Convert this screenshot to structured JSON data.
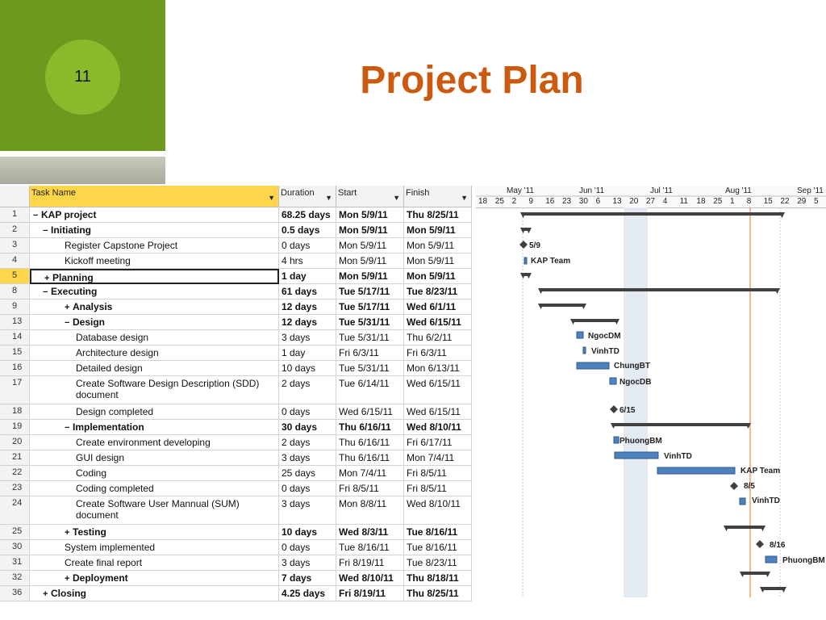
{
  "slide": {
    "number": "11",
    "title": "Project Plan"
  },
  "columns": {
    "id": "",
    "task": "Task Name",
    "duration": "Duration",
    "start": "Start",
    "finish": "Finish"
  },
  "timeline": {
    "months": [
      "May '11",
      "Jun '11",
      "Jul '11",
      "Aug '11",
      "Sep '11"
    ],
    "days": [
      "18",
      "25",
      "2",
      "9",
      "16",
      "23",
      "30",
      "6",
      "13",
      "20",
      "27",
      "4",
      "11",
      "18",
      "25",
      "1",
      "8",
      "15",
      "22",
      "29",
      "5"
    ]
  },
  "rows": [
    {
      "id": "1",
      "name": "KAP project",
      "dur": "68.25 days",
      "start": "Mon 5/9/11",
      "fin": "Thu 8/25/11",
      "bold": true,
      "level": 0,
      "toggle": "−"
    },
    {
      "id": "2",
      "name": "Initiating",
      "dur": "0.5 days",
      "start": "Mon 5/9/11",
      "fin": "Mon 5/9/11",
      "bold": true,
      "level": 1,
      "toggle": "−"
    },
    {
      "id": "3",
      "name": "Register Capstone Project",
      "dur": "0 days",
      "start": "Mon 5/9/11",
      "fin": "Mon 5/9/11",
      "bold": false,
      "level": 2,
      "toggle": ""
    },
    {
      "id": "4",
      "name": "Kickoff meeting",
      "dur": "4 hrs",
      "start": "Mon 5/9/11",
      "fin": "Mon 5/9/11",
      "bold": false,
      "level": 2,
      "toggle": ""
    },
    {
      "id": "5",
      "name": "Planning",
      "dur": "1 day",
      "start": "Mon 5/9/11",
      "fin": "Mon 5/9/11",
      "bold": true,
      "level": 1,
      "toggle": "+",
      "selected": true
    },
    {
      "id": "8",
      "name": "Executing",
      "dur": "61 days",
      "start": "Tue 5/17/11",
      "fin": "Tue 8/23/11",
      "bold": true,
      "level": 1,
      "toggle": "−"
    },
    {
      "id": "9",
      "name": "Analysis",
      "dur": "12 days",
      "start": "Tue 5/17/11",
      "fin": "Wed 6/1/11",
      "bold": true,
      "level": 2,
      "toggle": "+"
    },
    {
      "id": "13",
      "name": "Design",
      "dur": "12 days",
      "start": "Tue 5/31/11",
      "fin": "Wed 6/15/11",
      "bold": true,
      "level": 2,
      "toggle": "−"
    },
    {
      "id": "14",
      "name": "Database design",
      "dur": "3 days",
      "start": "Tue 5/31/11",
      "fin": "Thu 6/2/11",
      "bold": false,
      "level": 3,
      "toggle": ""
    },
    {
      "id": "15",
      "name": "Architecture design",
      "dur": "1 day",
      "start": "Fri 6/3/11",
      "fin": "Fri 6/3/11",
      "bold": false,
      "level": 3,
      "toggle": ""
    },
    {
      "id": "16",
      "name": "Detailed design",
      "dur": "10 days",
      "start": "Tue 5/31/11",
      "fin": "Mon 6/13/11",
      "bold": false,
      "level": 3,
      "toggle": ""
    },
    {
      "id": "17",
      "name": "Create Software Design Description (SDD)",
      "name2": "document",
      "dur": "2 days",
      "start": "Tue 6/14/11",
      "fin": "Wed 6/15/11",
      "bold": false,
      "level": 3,
      "toggle": ""
    },
    {
      "id": "18",
      "name": "Design completed",
      "dur": "0 days",
      "start": "Wed 6/15/11",
      "fin": "Wed 6/15/11",
      "bold": false,
      "level": 3,
      "toggle": ""
    },
    {
      "id": "19",
      "name": "Implementation",
      "dur": "30 days",
      "start": "Thu 6/16/11",
      "fin": "Wed 8/10/11",
      "bold": true,
      "level": 2,
      "toggle": "−"
    },
    {
      "id": "20",
      "name": "Create environment developing",
      "dur": "2 days",
      "start": "Thu 6/16/11",
      "fin": "Fri 6/17/11",
      "bold": false,
      "level": 3,
      "toggle": ""
    },
    {
      "id": "21",
      "name": "GUI design",
      "dur": "3 days",
      "start": "Thu 6/16/11",
      "fin": "Mon 7/4/11",
      "bold": false,
      "level": 3,
      "toggle": ""
    },
    {
      "id": "22",
      "name": "Coding",
      "dur": "25 days",
      "start": "Mon 7/4/11",
      "fin": "Fri 8/5/11",
      "bold": false,
      "level": 3,
      "toggle": ""
    },
    {
      "id": "23",
      "name": "Coding completed",
      "dur": "0 days",
      "start": "Fri 8/5/11",
      "fin": "Fri 8/5/11",
      "bold": false,
      "level": 3,
      "toggle": ""
    },
    {
      "id": "24",
      "name": "Create Software User Mannual (SUM)",
      "name2": "document",
      "dur": "3 days",
      "start": "Mon 8/8/11",
      "fin": "Wed 8/10/11",
      "bold": false,
      "level": 3,
      "toggle": ""
    },
    {
      "id": "25",
      "name": "Testing",
      "dur": "10 days",
      "start": "Wed 8/3/11",
      "fin": "Tue 8/16/11",
      "bold": true,
      "level": 2,
      "toggle": "+"
    },
    {
      "id": "30",
      "name": "System implemented",
      "dur": "0 days",
      "start": "Tue 8/16/11",
      "fin": "Tue 8/16/11",
      "bold": false,
      "level": 2,
      "toggle": ""
    },
    {
      "id": "31",
      "name": "Create final report",
      "dur": "3 days",
      "start": "Fri 8/19/11",
      "fin": "Tue 8/23/11",
      "bold": false,
      "level": 2,
      "toggle": ""
    },
    {
      "id": "32",
      "name": "Deployment",
      "dur": "7 days",
      "start": "Wed 8/10/11",
      "fin": "Thu 8/18/11",
      "bold": true,
      "level": 2,
      "toggle": "+"
    },
    {
      "id": "36",
      "name": "Closing",
      "dur": "4.25 days",
      "start": "Fri 8/19/11",
      "fin": "Thu 8/25/11",
      "bold": true,
      "level": 1,
      "toggle": "+"
    }
  ],
  "gantt_labels": [
    "5/9",
    "KAP Team",
    "NgocDM",
    "VinhTD",
    "ChungBT",
    "NgocDB",
    "6/15",
    "PhuongBM",
    "VinhTD",
    "KAP Team",
    "8/5",
    "VinhTD",
    "8/16",
    "PhuongBM"
  ],
  "colors": {
    "green": "#6b9a1e",
    "circle": "#8ab92c",
    "title": "#cb5a0f",
    "header_highlight": "#ffd54a",
    "bar_blue": "#4f81bd"
  }
}
